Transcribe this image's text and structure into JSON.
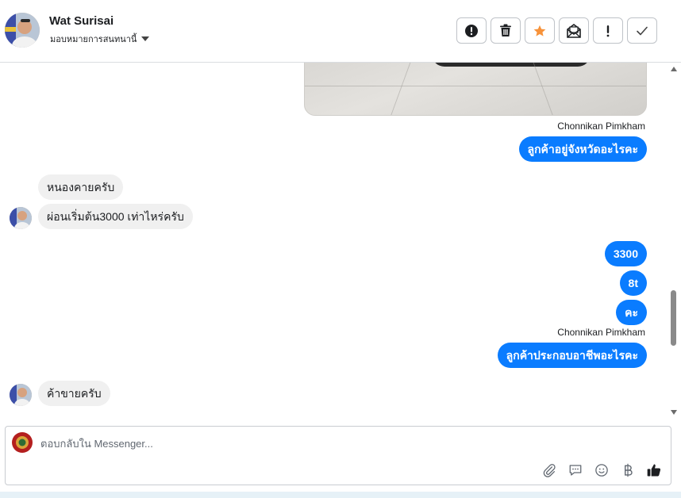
{
  "header": {
    "contact_name": "Wat Surisai",
    "assign_label": "มอบหมายการสนทนานี้",
    "actions": [
      {
        "name": "spam-alert",
        "icon": "alert-circle-icon"
      },
      {
        "name": "delete",
        "icon": "trash-icon"
      },
      {
        "name": "star",
        "icon": "star-icon",
        "color": "#f7923a"
      },
      {
        "name": "mark-unread",
        "icon": "envelope-open-icon"
      },
      {
        "name": "important",
        "icon": "exclamation-icon"
      },
      {
        "name": "done",
        "icon": "checkmark-icon"
      }
    ]
  },
  "thread": {
    "sender_1": "Chonnikan Pimkham",
    "msg_out_1": "ลูกค้าอยู่จังหวัดอะไรคะ",
    "msg_in_1": "หนองคายครับ",
    "msg_in_2": "ผ่อนเริ่มต้น3000 เท่าไหร่ครับ",
    "msg_out_2": "3300",
    "msg_out_3": "8t",
    "msg_out_4": "คะ",
    "sender_2": "Chonnikan Pimkham",
    "msg_out_5": "ลูกค้าประกอบอาชีพอะไรคะ",
    "msg_in_3": "ค้าขายครับ"
  },
  "composer": {
    "placeholder": "ตอบกลับใน Messenger...",
    "value": "",
    "tools": [
      "paperclip-icon",
      "saved-reply-icon",
      "emoji-icon",
      "baht-icon",
      "thumbs-up-icon"
    ]
  },
  "colors": {
    "outgoing_bubble": "#0a7cff",
    "incoming_bubble": "#f0f0f0",
    "star": "#f7923a"
  }
}
